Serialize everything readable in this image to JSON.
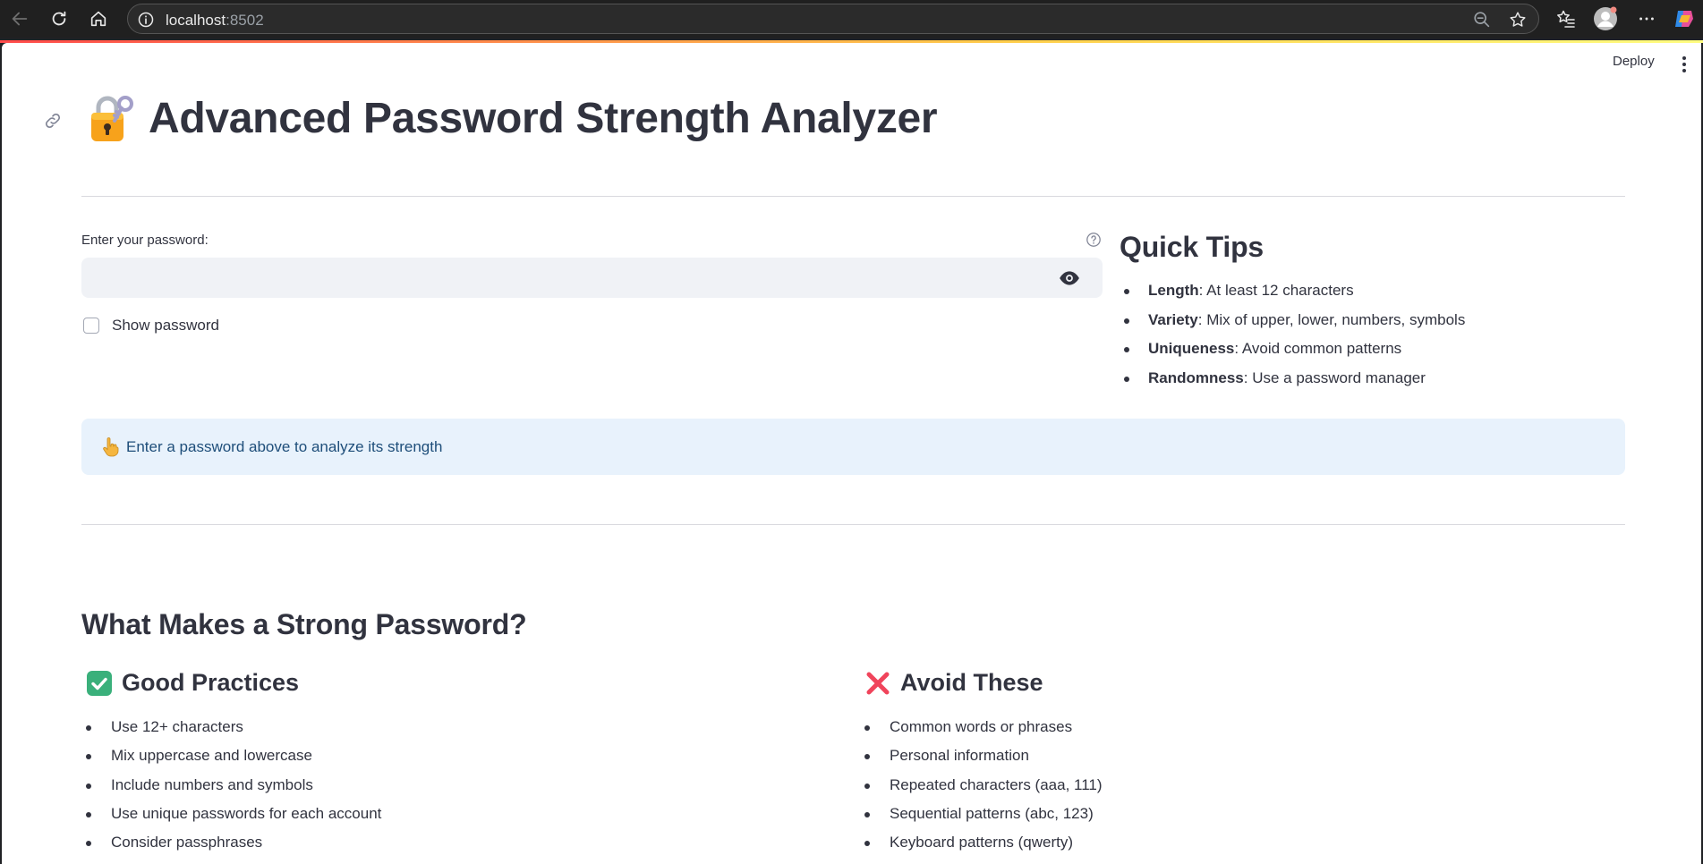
{
  "browser": {
    "url_host": "localhost",
    "url_port": ":8502"
  },
  "app": {
    "deploy_label": "Deploy",
    "title": "Advanced Password Strength Analyzer",
    "title_icon": "locked-with-key-icon"
  },
  "password": {
    "label": "Enter your password:",
    "value": "",
    "placeholder": "",
    "show_password_label": "Show password",
    "show_password_checked": false
  },
  "quick_tips": {
    "title": "Quick Tips",
    "items": [
      {
        "key": "Length",
        "text": ": At least 12 characters"
      },
      {
        "key": "Variety",
        "text": ": Mix of upper, lower, numbers, symbols"
      },
      {
        "key": "Uniqueness",
        "text": ": Avoid common patterns"
      },
      {
        "key": "Randomness",
        "text": ": Use a password manager"
      }
    ]
  },
  "info": {
    "icon": "pointing-up-hand-icon",
    "text": "Enter a password above to analyze its strength"
  },
  "strong_password": {
    "title": "What Makes a Strong Password?",
    "good": {
      "icon": "check-mark-icon",
      "title": "Good Practices",
      "items": [
        "Use 12+ characters",
        "Mix uppercase and lowercase",
        "Include numbers and symbols",
        "Use unique passwords for each account",
        "Consider passphrases"
      ]
    },
    "avoid": {
      "icon": "cross-mark-icon",
      "title": "Avoid These",
      "items": [
        "Common words or phrases",
        "Personal information",
        "Repeated characters (aaa, 111)",
        "Sequential patterns (abc, 123)",
        "Keyboard patterns (qwerty)"
      ]
    }
  },
  "colors": {
    "text": "#31333f",
    "input_bg": "#f0f2f6",
    "info_bg": "#e8f2fc",
    "info_text": "#1e4e7a",
    "accent_red": "#ff4b4b"
  }
}
